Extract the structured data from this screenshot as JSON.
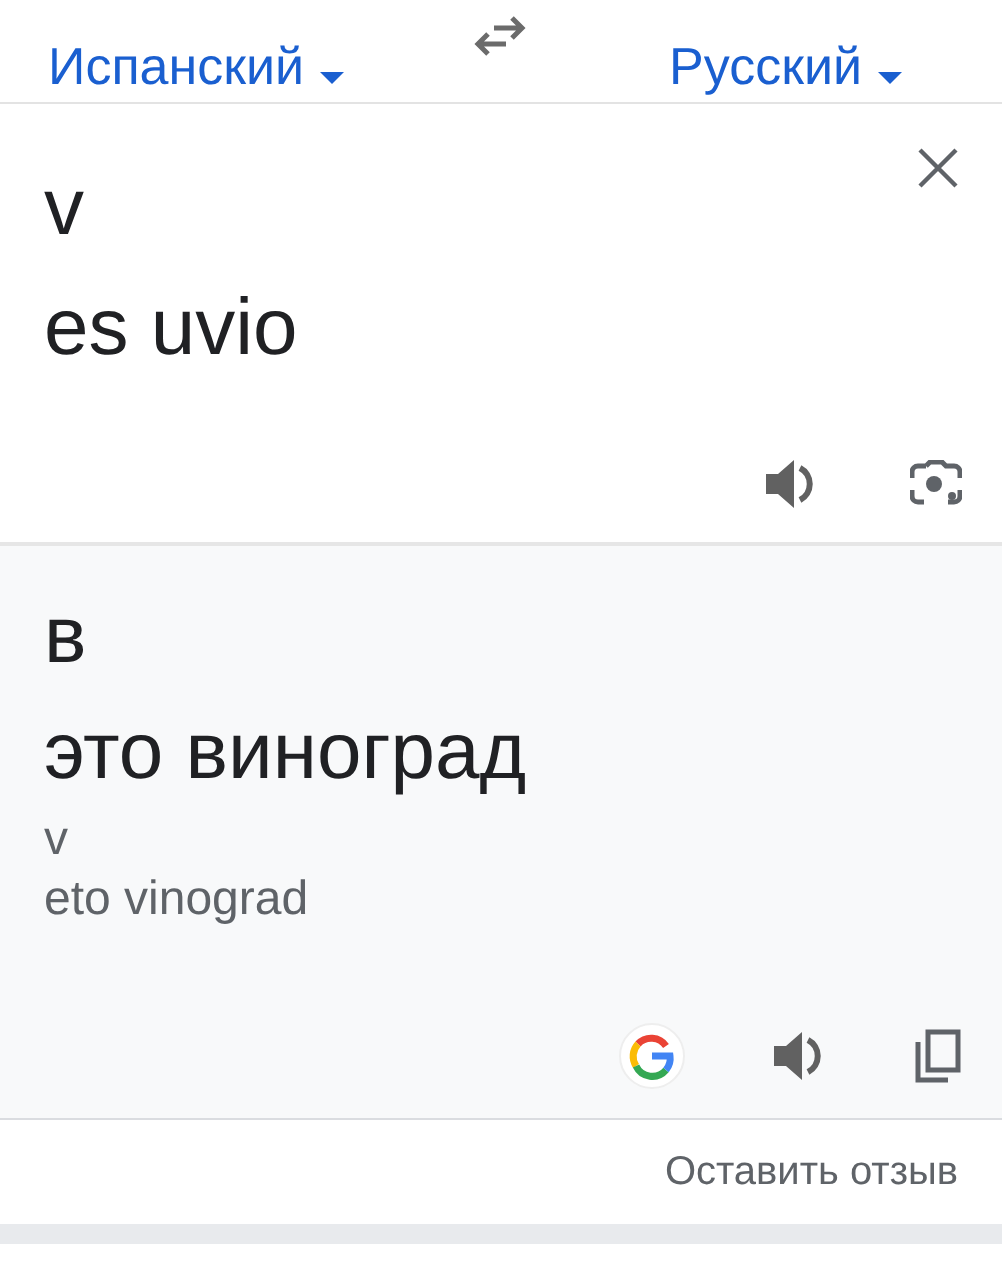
{
  "source_language": "Испанский",
  "target_language": "Русский",
  "input": {
    "lines": [
      "v",
      "es uvio"
    ]
  },
  "output": {
    "lines": [
      "в",
      "это виноград"
    ],
    "transliteration": [
      "v",
      "eto vinograd"
    ]
  },
  "feedback_link": "Оставить отзыв"
}
